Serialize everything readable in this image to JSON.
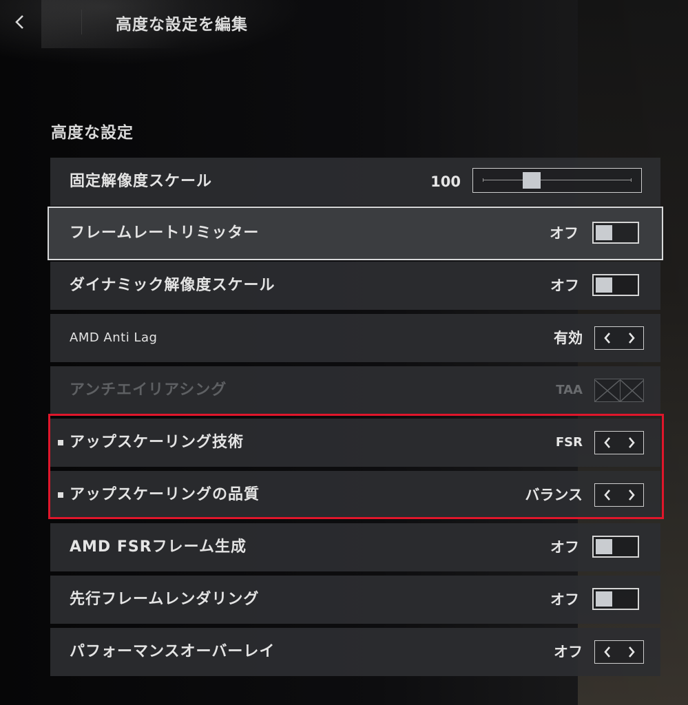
{
  "header": {
    "back_icon": "chevron-left-icon",
    "title": "高度な設定を編集"
  },
  "section": {
    "title": "高度な設定"
  },
  "settings": [
    {
      "label": "固定解像度スケール",
      "control": "slider",
      "value": "100",
      "slider_fraction": 0.33
    },
    {
      "label": "フレームレートリミッター",
      "control": "toggle",
      "value": "オフ",
      "selected": true
    },
    {
      "label": "ダイナミック解像度スケール",
      "control": "toggle",
      "value": "オフ"
    },
    {
      "label": "AMD Anti Lag",
      "control": "stepper",
      "value": "有効"
    },
    {
      "label": "アンチエイリアシング",
      "control": "stepper-disabled",
      "value": "TAA",
      "disabled": true
    },
    {
      "label": "アップスケーリング技術",
      "control": "stepper",
      "value": "FSR",
      "bulleted": true,
      "highlighted": true
    },
    {
      "label": "アップスケーリングの品質",
      "control": "stepper",
      "value": "バランス",
      "bulleted": true,
      "highlighted": true
    },
    {
      "label": "AMD FSRフレーム生成",
      "control": "toggle",
      "value": "オフ"
    },
    {
      "label": "先行フレームレンダリング",
      "control": "toggle",
      "value": "オフ"
    },
    {
      "label": "パフォーマンスオーバーレイ",
      "control": "stepper",
      "value": "オフ"
    }
  ],
  "colors": {
    "highlight": "#e0162b",
    "row_bg": "#2c2e31",
    "text": "#e4e4e4",
    "disabled_text": "#5e6063"
  }
}
